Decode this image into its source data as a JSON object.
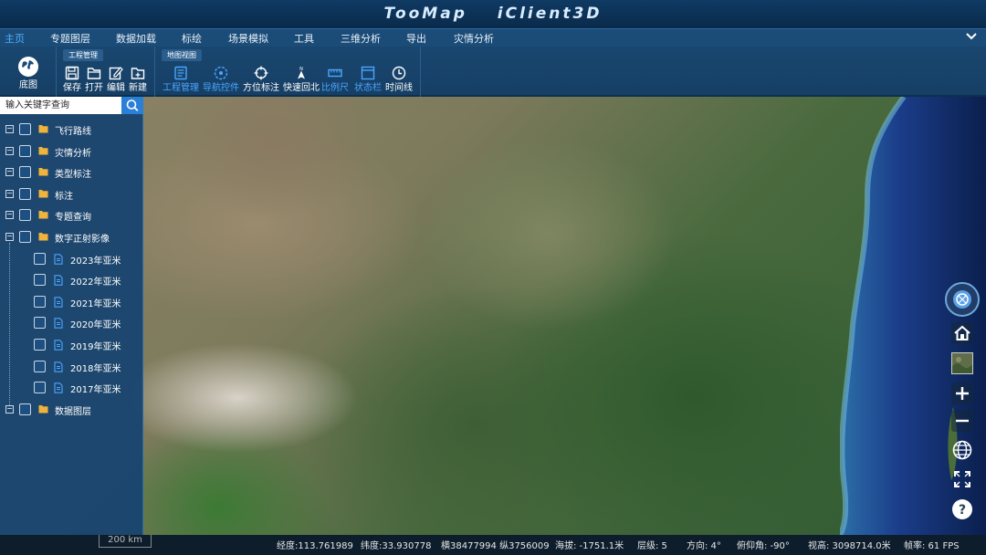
{
  "app": {
    "title": "TooMap   iClient3D"
  },
  "menu": {
    "items": [
      "主页",
      "专题图层",
      "数据加载",
      "标绘",
      "场景模拟",
      "工具",
      "三维分析",
      "导出",
      "灾情分析"
    ],
    "active_index": 0,
    "collapse_icon": "chevron-down-icon"
  },
  "ribbon": {
    "basemap_label": "底图",
    "project_group": {
      "title": "工程管理",
      "buttons": [
        "保存",
        "打开",
        "编辑",
        "新建"
      ]
    },
    "view_group": {
      "title": "地图视图",
      "buttons": [
        "工程管理",
        "导航控件",
        "方位标注",
        "快速回北",
        "比例尺",
        "状态栏",
        "时间线"
      ]
    }
  },
  "panel": {
    "search_placeholder": "输入关键字查询",
    "tree": [
      {
        "label": "飞行路线",
        "level": 0,
        "type": "folder",
        "expanded": false
      },
      {
        "label": "灾情分析",
        "level": 0,
        "type": "folder",
        "expanded": false
      },
      {
        "label": "类型标注",
        "level": 0,
        "type": "folder",
        "expanded": false
      },
      {
        "label": "标注",
        "level": 0,
        "type": "folder",
        "expanded": false
      },
      {
        "label": "专题查询",
        "level": 0,
        "type": "folder",
        "expanded": false
      },
      {
        "label": "数字正射影像",
        "level": 0,
        "type": "folder",
        "expanded": true
      },
      {
        "label": "2023年亚米",
        "level": 1,
        "type": "file"
      },
      {
        "label": "2022年亚米",
        "level": 1,
        "type": "file"
      },
      {
        "label": "2021年亚米",
        "level": 1,
        "type": "file"
      },
      {
        "label": "2020年亚米",
        "level": 1,
        "type": "file"
      },
      {
        "label": "2019年亚米",
        "level": 1,
        "type": "file"
      },
      {
        "label": "2018年亚米",
        "level": 1,
        "type": "file"
      },
      {
        "label": "2017年亚米",
        "level": 1,
        "type": "file"
      },
      {
        "label": "数据图层",
        "level": 0,
        "type": "folder",
        "expanded": false
      }
    ]
  },
  "status": {
    "scale": "200 km",
    "longitude": "经度:113.761989",
    "latitude": "纬度:33.930778",
    "projected": "横38477994 纵3756009",
    "altitude": "海拔: -1751.1米",
    "level": "层级:  5",
    "heading": "方向:  4°",
    "pitch": "俯仰角: -90°",
    "view_height": "视高: 3098714.0米",
    "fps": "帧率: 61 FPS"
  },
  "colors": {
    "accent": "#2f8ff0",
    "ribbon_blue_label": "#4aa6ff",
    "panel_bg": "#154270"
  }
}
